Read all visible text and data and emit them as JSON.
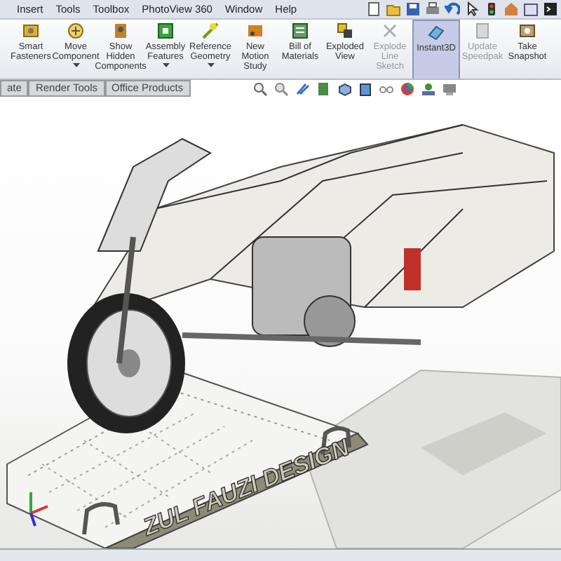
{
  "menu_bar": {
    "items": [
      "Insert",
      "Tools",
      "Toolbox",
      "PhotoView 360",
      "Window",
      "Help"
    ]
  },
  "ribbon": {
    "buttons": [
      {
        "lines": [
          "Smart",
          "Fasteners"
        ],
        "kind": "fastener",
        "dropdown": false,
        "disabled": false,
        "selected": false
      },
      {
        "lines": [
          "Move",
          "Component"
        ],
        "kind": "move",
        "dropdown": true,
        "disabled": false,
        "selected": false
      },
      {
        "lines": [
          "Show",
          "Hidden",
          "Components"
        ],
        "kind": "show",
        "dropdown": false,
        "disabled": false,
        "selected": false
      },
      {
        "lines": [
          "Assembly",
          "Features"
        ],
        "kind": "assembly",
        "dropdown": true,
        "disabled": false,
        "selected": false
      },
      {
        "lines": [
          "Reference",
          "Geometry"
        ],
        "kind": "reference",
        "dropdown": true,
        "disabled": false,
        "selected": false
      },
      {
        "lines": [
          "New",
          "Motion",
          "Study"
        ],
        "kind": "motion",
        "dropdown": false,
        "disabled": false,
        "selected": false
      },
      {
        "lines": [
          "Bill of",
          "Materials"
        ],
        "kind": "bom",
        "dropdown": false,
        "disabled": false,
        "selected": false
      },
      {
        "lines": [
          "Exploded",
          "View"
        ],
        "kind": "explode",
        "dropdown": false,
        "disabled": false,
        "selected": false
      },
      {
        "lines": [
          "Explode",
          "Line",
          "Sketch"
        ],
        "kind": "sketch",
        "dropdown": false,
        "disabled": true,
        "selected": false
      },
      {
        "lines": [
          "Instant3D"
        ],
        "kind": "instant",
        "dropdown": false,
        "disabled": false,
        "selected": true
      },
      {
        "lines": [
          "Update",
          "Speedpak"
        ],
        "kind": "speedpak",
        "dropdown": false,
        "disabled": true,
        "selected": false
      },
      {
        "lines": [
          "Take",
          "Snapshot"
        ],
        "kind": "snapshot",
        "dropdown": false,
        "disabled": false,
        "selected": false
      }
    ]
  },
  "tabs": [
    {
      "label": "ate",
      "selected": false
    },
    {
      "label": "Render Tools",
      "selected": false
    },
    {
      "label": "Office Products",
      "selected": false
    }
  ],
  "viewport": {
    "model_engraving": "ZUL FAUZI DESIGN"
  }
}
